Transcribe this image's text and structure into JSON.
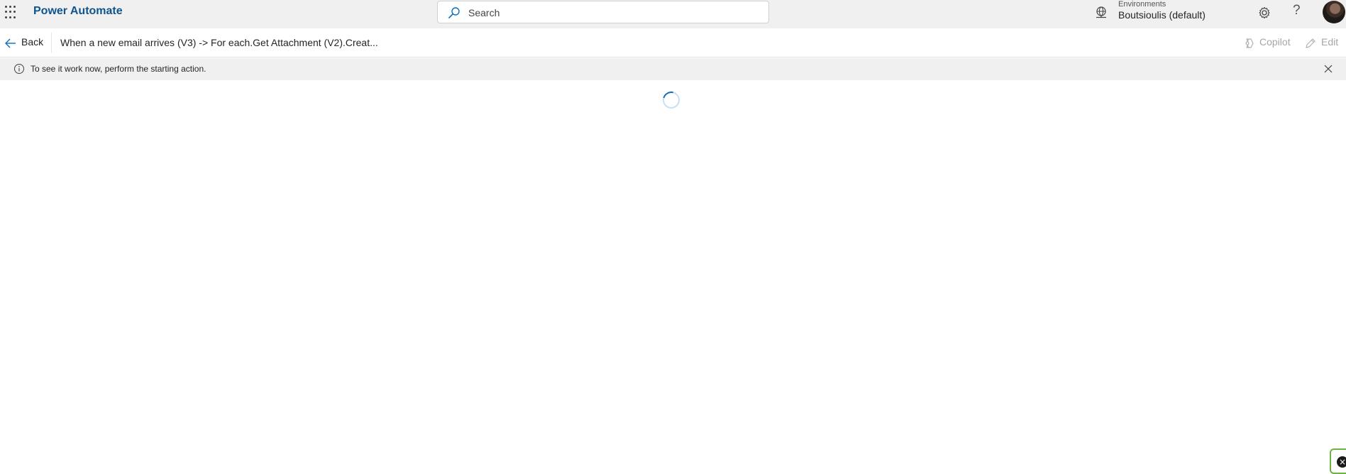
{
  "header": {
    "app_title": "Power Automate",
    "search_placeholder": "Search",
    "environment_label": "Environments",
    "environment_value": "Boutsioulis (default)",
    "help_glyph": "?"
  },
  "command_bar": {
    "back_label": "Back",
    "flow_title": "When a new email arrives (V3) -> For each.Get Attachment (V2).Creat...",
    "copilot_label": "Copilot",
    "edit_label": "Edit"
  },
  "message_bar": {
    "text": "To see it work now, perform the starting action."
  },
  "icons": {
    "waffle": "app-launcher-icon",
    "search": "search-icon",
    "environment": "environment-globe-icon",
    "settings": "gear-icon",
    "help": "help-icon",
    "back": "arrow-left-icon",
    "copilot": "copilot-icon",
    "edit": "pencil-icon",
    "info": "info-icon",
    "close": "close-icon"
  },
  "colors": {
    "brand": "#0f548c",
    "accent": "#0f6cbd",
    "header_bg": "#f0f0f0",
    "disabled_text": "#a6a6a6",
    "corner_widget_border": "#6cb33f"
  }
}
